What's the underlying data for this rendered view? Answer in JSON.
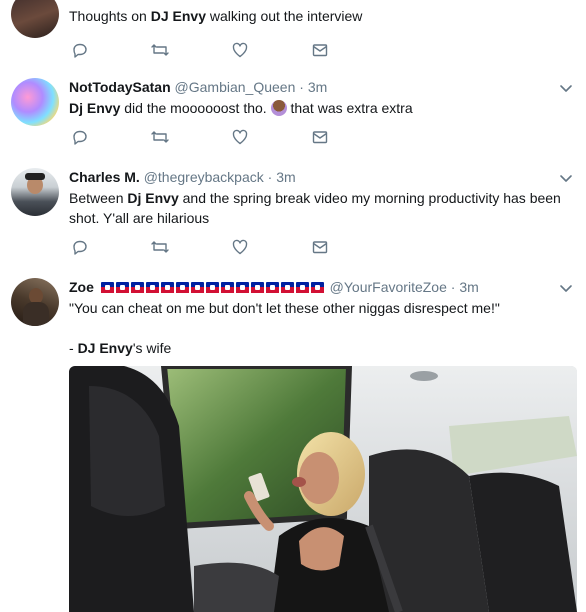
{
  "tweets": [
    {
      "text_before": "Thoughts on ",
      "bold": "DJ Envy",
      "text_after": " walking out the interview"
    },
    {
      "name": "NotTodaySatan",
      "handle": "@Gambian_Queen",
      "time": "· 3m",
      "bold": "Dj Envy",
      "text_mid": " did the moooooost tho. ",
      "text_after": " that was extra extra"
    },
    {
      "name": "Charles M.",
      "handle": "@thegreybackpack",
      "time": "· 3m",
      "text_before": "Between ",
      "bold": "Dj Envy",
      "text_after": " and the spring break video my morning productivity has been shot. Y'all are hilarious"
    },
    {
      "name": "Zoe",
      "handle": "@YourFavoriteZoe",
      "time": "· 3m",
      "line1": "\"You can cheat on me but don't let these other niggas disrespect me!\"",
      "line2_before": "- ",
      "line2_bold": "DJ Envy",
      "line2_after": "'s wife"
    }
  ],
  "colors": {
    "icon": "#657786",
    "border": "#e6ecf0",
    "handle": "#657786"
  }
}
